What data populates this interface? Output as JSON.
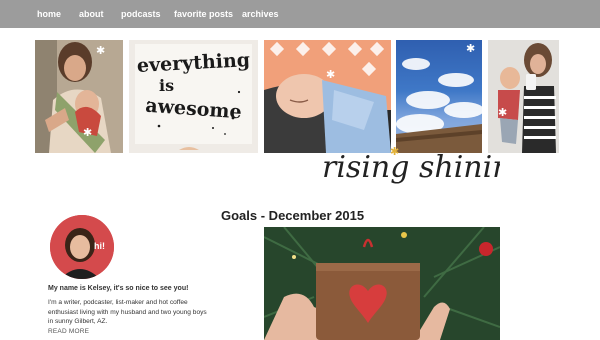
{
  "nav": {
    "items": [
      {
        "label": "home"
      },
      {
        "label": "about"
      },
      {
        "label": "podcasts"
      },
      {
        "label": "favorite posts"
      },
      {
        "label": "archives"
      }
    ]
  },
  "header": {
    "site_title": "rising shining",
    "sign_text_line1": "everything",
    "sign_text_line2": "is",
    "sign_text_line3": "awesome",
    "avatar_badge": "hi!"
  },
  "sidebar": {
    "greeting": "My name is Kelsey, it's so nice to see you!",
    "bio": "I'm a writer, podcaster, list-maker and hot coffee enthusiast living with my husband and two young boys in sunny Gilbert, AZ.",
    "read_more": "READ MORE"
  },
  "post": {
    "title": "Goals - December 2015"
  },
  "colors": {
    "nav_bg": "#9c9c9c",
    "nav_text": "#ffffff",
    "avatar_bg": "#d44a4c",
    "heart": "#d73d3d"
  },
  "icons": {
    "sparkle": "sparkle-icon"
  }
}
